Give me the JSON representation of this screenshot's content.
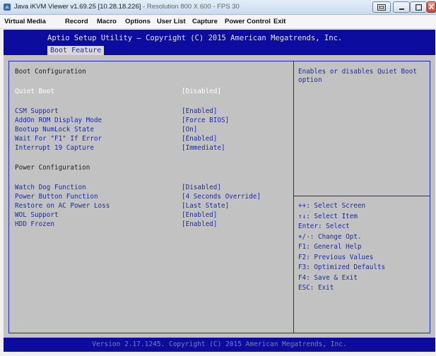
{
  "window": {
    "title": "Java iKVM Viewer v1.69.25 [10.28.18.226]",
    "title_suffix": " - Resolution 800 X 600 - FPS 30",
    "close_glyph": "X"
  },
  "menubar": {
    "items": [
      "Virtual Media",
      "Record",
      "Macro",
      "Options",
      "User List",
      "Capture",
      "Power Control",
      "Exit"
    ]
  },
  "bios": {
    "header": "Aptio Setup Utility – Copyright (C) 2015 American Megatrends, Inc.",
    "tab": "Boot Feature",
    "section_boot": "Boot Configuration",
    "section_power": "Power Configuration",
    "items": [
      {
        "label": "Quiet Boot",
        "value": "[Disabled]"
      },
      {
        "label": "CSM Support",
        "value": "[Enabled]"
      },
      {
        "label": "AddOn ROM Display Mode",
        "value": "[Force BIOS]"
      },
      {
        "label": "Bootup NumLock State",
        "value": "[On]"
      },
      {
        "label": "Wait For \"F1\" If Error",
        "value": "[Enabled]"
      },
      {
        "label": "Interrupt 19 Capture",
        "value": "[Immediate]"
      },
      {
        "label": "Watch Dog Function",
        "value": "[Disabled]"
      },
      {
        "label": "Power Button Function",
        "value": "[4 Seconds Override]"
      },
      {
        "label": "Restore on AC Power Loss",
        "value": "[Last State]"
      },
      {
        "label": "WOL Support",
        "value": "[Enabled]"
      },
      {
        "label": "HDD Frozen",
        "value": "[Enabled]"
      }
    ],
    "help_text_1": "Enables or disables Quiet Boot",
    "help_text_2": "option",
    "keys": [
      "++: Select Screen",
      "↑↓: Select Item",
      "Enter: Select",
      "+/-: Change Opt.",
      "F1: General Help",
      "F2: Previous Values",
      "F3: Optimized Defaults",
      "F4: Save & Exit",
      "ESC: Exit"
    ],
    "footer": "Version 2.17.1245. Copyright (C) 2015 American Megatrends, Inc."
  },
  "colors": {
    "bios_blue": "#0c0c9e",
    "bios_gray": "#c2c2c2",
    "label_blue": "#1d2ca8"
  }
}
